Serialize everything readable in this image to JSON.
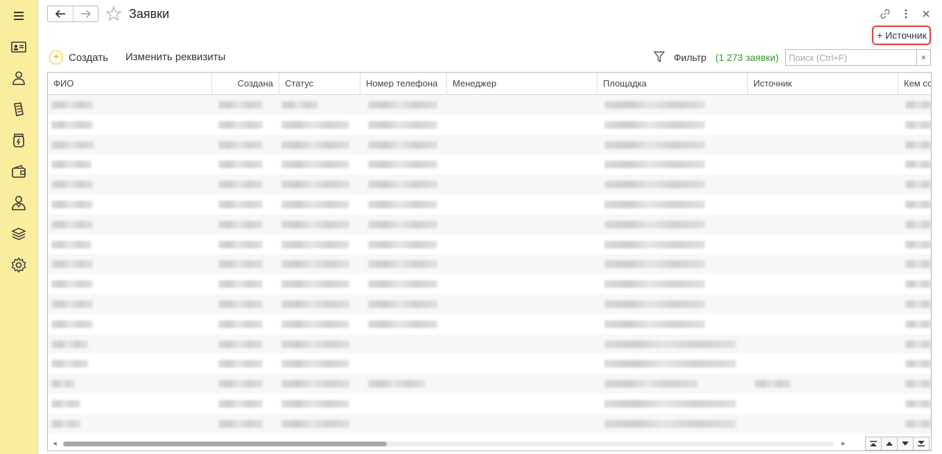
{
  "window": {
    "title": "Заявки"
  },
  "sidebar": {
    "items": [
      {
        "icon": "menu-icon"
      },
      {
        "icon": "contact-card-icon"
      },
      {
        "icon": "person-icon"
      },
      {
        "icon": "document-icon"
      },
      {
        "icon": "jar-icon"
      },
      {
        "icon": "wallet-icon"
      },
      {
        "icon": "user-icon"
      },
      {
        "icon": "layers-icon"
      },
      {
        "icon": "gear-icon"
      }
    ]
  },
  "header": {
    "source_button_label": "+ Источник"
  },
  "toolbar": {
    "create_label": "Создать",
    "edit_label": "Изменить реквизиты",
    "filter_label": "Фильтр",
    "count_label": "(1 273 заявки)",
    "search_placeholder": "Поиск (Ctrl+F)",
    "search_clear": "×"
  },
  "table": {
    "columns": [
      "ФИО",
      "Создана",
      "Статус",
      "Номер телефона",
      "Менеджер",
      "Площадка",
      "Источник",
      "Кем со"
    ],
    "row_count_visible": 17
  },
  "scroll": {
    "horizontal_position": 0.42
  },
  "colors": {
    "sidebar_bg": "#fbed9e",
    "accent_yellow": "#e8c12b",
    "count_green": "#2e9b2e",
    "highlight_red": "#d94545"
  }
}
